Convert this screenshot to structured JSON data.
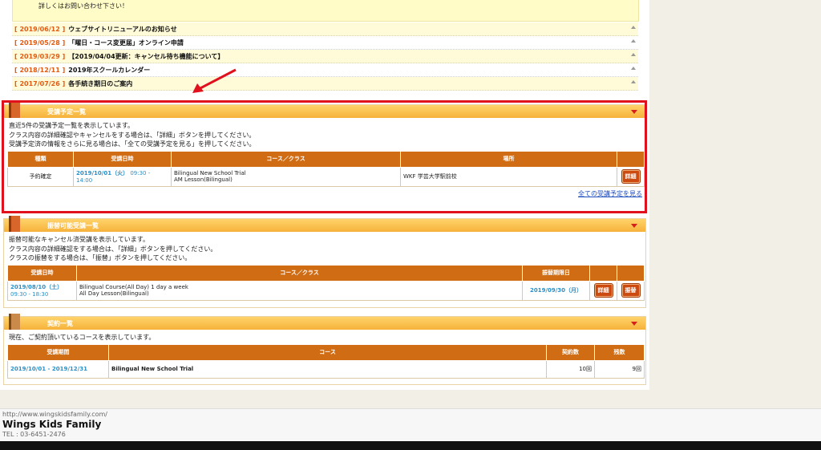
{
  "notice": {
    "text": "詳しくはお問い合わせ下さい！"
  },
  "news": [
    {
      "date": "[ 2019/06/12 ]",
      "title": "ウェブサイトリニューアルのお知らせ"
    },
    {
      "date": "[ 2019/05/28 ]",
      "title": "「曜日・コース変更届」オンライン申請"
    },
    {
      "date": "[ 2019/03/29 ]",
      "title": "【2019/04/04更新：キャンセル待ち機能について】"
    },
    {
      "date": "[ 2018/12/11 ]",
      "title": "2019年スクールカレンダー"
    },
    {
      "date": "[ 2017/07/26 ]",
      "title": "各手続き期日のご案内"
    }
  ],
  "schedule": {
    "title": "受講予定一覧",
    "desc1": "直近5件の受講予定一覧を表示しています。",
    "desc2": "クラス内容の詳細確認やキャンセルをする場合は、「詳細」ボタンを押してください。",
    "desc3": "受講予定済の情報をさらに見る場合は、「全ての受講予定を見る」を押してください。",
    "headers": {
      "type": "種類",
      "date": "受講日時",
      "course": "コース／クラス",
      "place": "場所"
    },
    "row": {
      "type": "予約確定",
      "date": "2019/10/01（火）",
      "time1": "09:30 -",
      "time2": "14:00",
      "course1": "Bilingual New School Trial",
      "course2": "AM Lesson(Bilingual)",
      "place": "WKF 学芸大学駅前校",
      "detail_btn": "詳細"
    },
    "view_all": "全ての受講予定を見る"
  },
  "transfer": {
    "title": "振替可能受講一覧",
    "desc1": "振替可能なキャンセル済受講を表示しています。",
    "desc2": "クラス内容の詳細確認をする場合は、「詳細」ボタンを押してください。",
    "desc3": "クラスの振替をする場合は、「振替」ボタンを押してください。",
    "headers": {
      "date": "受講日時",
      "course": "コース／クラス",
      "deadline": "振替期限日"
    },
    "row": {
      "date": "2019/08/10（土）",
      "time": "09:30 - 18:30",
      "course1": "Bilingual Course(All Day) 1 day a week",
      "course2": "All Day Lesson(Bilingual)",
      "deadline": "2019/09/30（月）",
      "detail_btn": "詳細",
      "transfer_btn": "振替"
    }
  },
  "contract": {
    "title": "契約一覧",
    "desc": "現在、ご契約頂いているコースを表示しています。",
    "headers": {
      "period": "受講期間",
      "course": "コース",
      "count": "契約数",
      "remaining": "残数"
    },
    "row": {
      "period": "2019/10/01 - 2019/12/31",
      "course": "Bilingual New School Trial",
      "count": "10回",
      "remaining": "9回"
    }
  },
  "footer": {
    "url": "http://www.wingskidsfamily.com/",
    "name": "Wings Kids Family",
    "tel": "TEL : 03-6451-2476"
  },
  "colors": {
    "accent": "#d06c13",
    "highlight": "#e0101d",
    "link": "#2b8fc7"
  }
}
